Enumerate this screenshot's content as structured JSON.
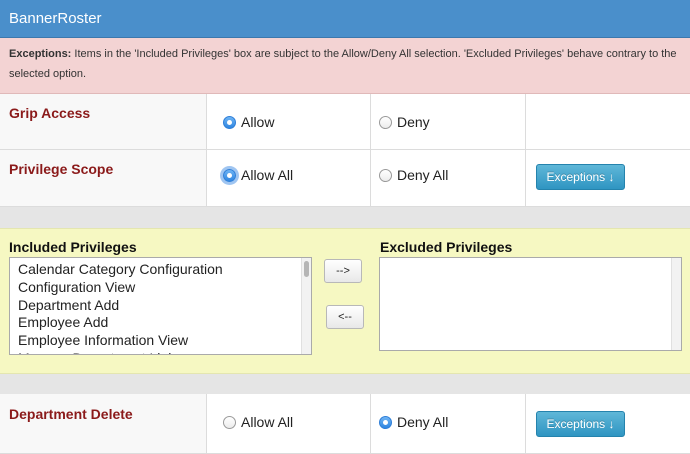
{
  "header": {
    "title": "BannerRoster"
  },
  "notice": {
    "label": "Exceptions:",
    "text": "Items in the 'Included Privileges' box are subject to the Allow/Deny All selection. 'Excluded Privileges' behave contrary to the selected option."
  },
  "grip_access": {
    "label": "Grip Access",
    "allow": "Allow",
    "deny": "Deny",
    "selected": "Allow"
  },
  "privilege_scope": {
    "label": "Privilege Scope",
    "allow_all": "Allow All",
    "deny_all": "Deny All",
    "selected": "Allow All",
    "exceptions_button": "Exceptions ↓"
  },
  "privileges": {
    "included_title": "Included Privileges",
    "excluded_title": "Excluded Privileges",
    "included_items": [
      "Calendar Category Configuration",
      "Configuration View",
      "Department Add",
      "Employee Add",
      "Employee Information View",
      "Manage Department Link"
    ],
    "excluded_items": [],
    "move_right": "-->",
    "move_left": "<--"
  },
  "department_delete": {
    "label": "Department Delete",
    "allow_all": "Allow All",
    "deny_all": "Deny All",
    "selected": "Deny All",
    "exceptions_button": "Exceptions ↓"
  },
  "colors": {
    "header_bg": "#4a8fcb",
    "notice_bg": "#f3d3d3",
    "label_text": "#8b1a1a",
    "privileges_bg": "#f6f8c2",
    "button_bg": "#3aa0cc"
  }
}
